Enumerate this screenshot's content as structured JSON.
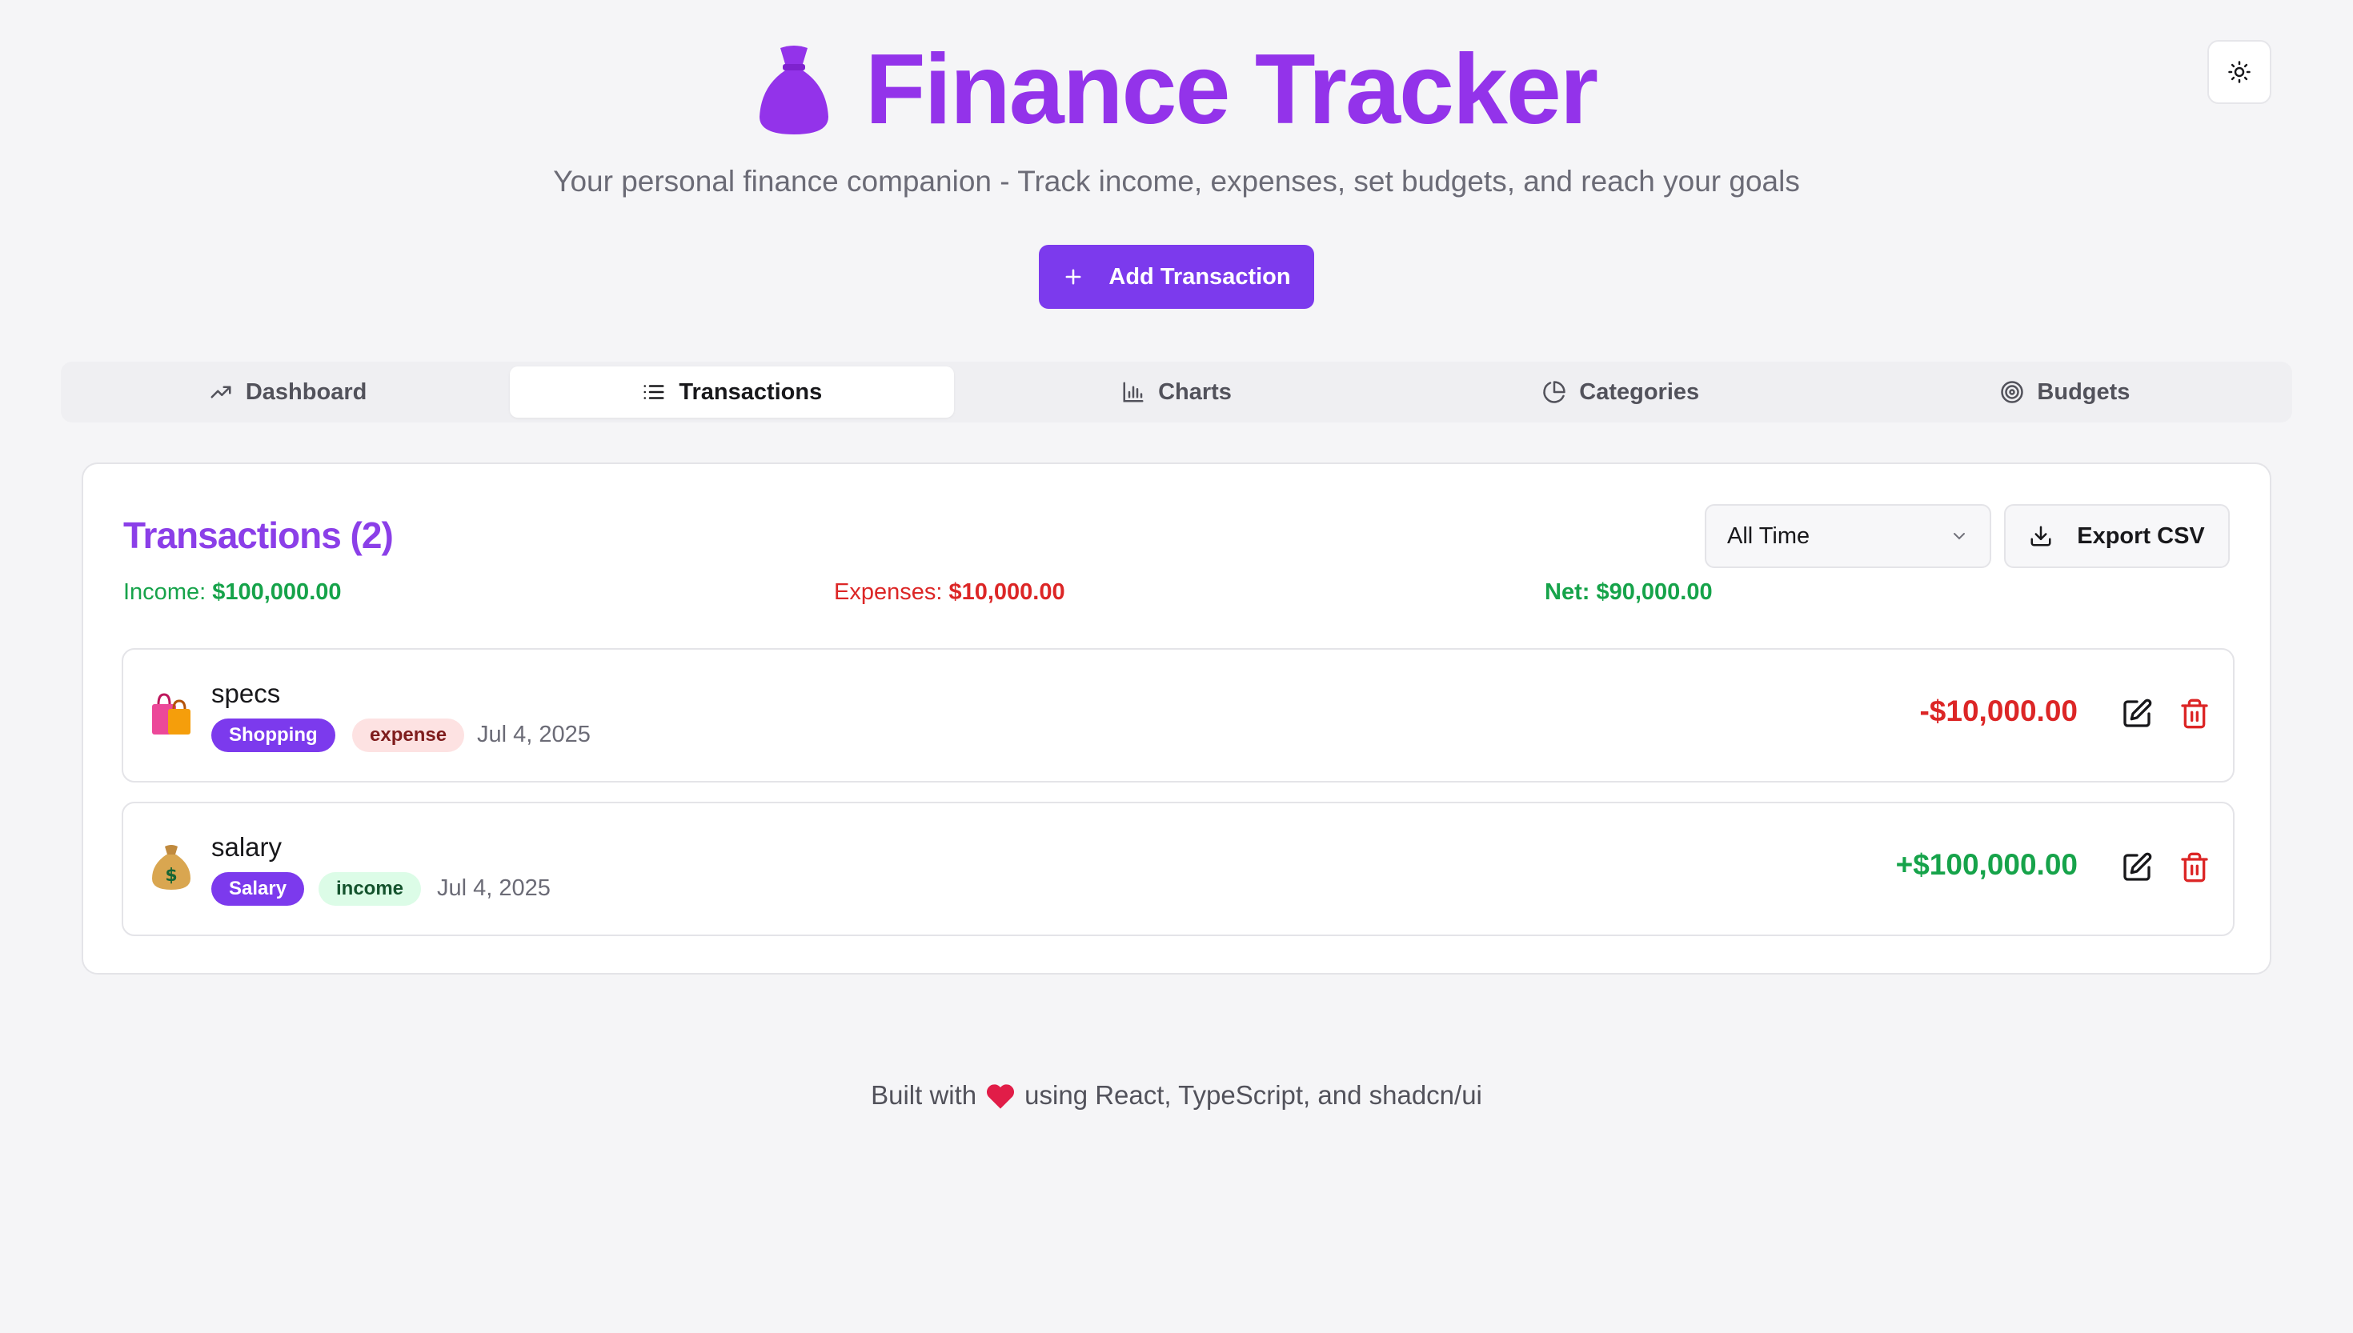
{
  "header": {
    "title": "Finance Tracker",
    "subtitle": "Your personal finance companion - Track income, expenses, set budgets, and reach your goals",
    "add_button": "Add Transaction"
  },
  "tabs": [
    {
      "label": "Dashboard",
      "icon": "trending-up-icon"
    },
    {
      "label": "Transactions",
      "icon": "list-icon",
      "active": true
    },
    {
      "label": "Charts",
      "icon": "bar-chart-icon"
    },
    {
      "label": "Categories",
      "icon": "pie-chart-icon"
    },
    {
      "label": "Budgets",
      "icon": "target-icon"
    }
  ],
  "transactions_card": {
    "title": "Transactions (2)",
    "filter": {
      "selected": "All Time"
    },
    "export_label": "Export CSV",
    "summary": {
      "income_label": "Income:",
      "income_value": "$100,000.00",
      "expenses_label": "Expenses:",
      "expenses_value": "$10,000.00",
      "net_label": "Net:",
      "net_value": "$90,000.00"
    },
    "items": [
      {
        "name": "specs",
        "category": "Shopping",
        "type": "expense",
        "date": "Jul 4, 2025",
        "amount": "-$10,000.00",
        "icon": "shopping-bags-icon"
      },
      {
        "name": "salary",
        "category": "Salary",
        "type": "income",
        "date": "Jul 4, 2025",
        "amount": "+$100,000.00",
        "icon": "money-bag-icon"
      }
    ]
  },
  "footer": {
    "before": "Built with",
    "after": "using React, TypeScript, and shadcn/ui"
  },
  "colors": {
    "accent": "#7c3aed",
    "title_purple": "#9333ea",
    "income_green": "#16a34a",
    "expense_red": "#dc2626"
  }
}
